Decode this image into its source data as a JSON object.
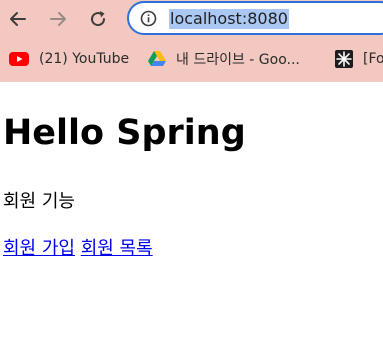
{
  "browser": {
    "address_bar": {
      "url": "localhost:8080"
    },
    "bookmarks": [
      {
        "label": "(21) YouTube",
        "icon": "youtube-icon"
      },
      {
        "label": "내 드라이브 - Goo...",
        "icon": "google-drive-icon"
      },
      {
        "label": "[Fo",
        "icon": "snowflake-icon"
      }
    ]
  },
  "page": {
    "title": "Hello Spring",
    "section_text": "회원 기능",
    "links": {
      "join": "회원 가입",
      "list": "회원 목록"
    }
  },
  "colors": {
    "bookmark_bar_bg": "#f2c8c0",
    "omnibox_border": "#2f6fd9",
    "url_selection": "#aac8f3",
    "link": "#0000ee"
  }
}
